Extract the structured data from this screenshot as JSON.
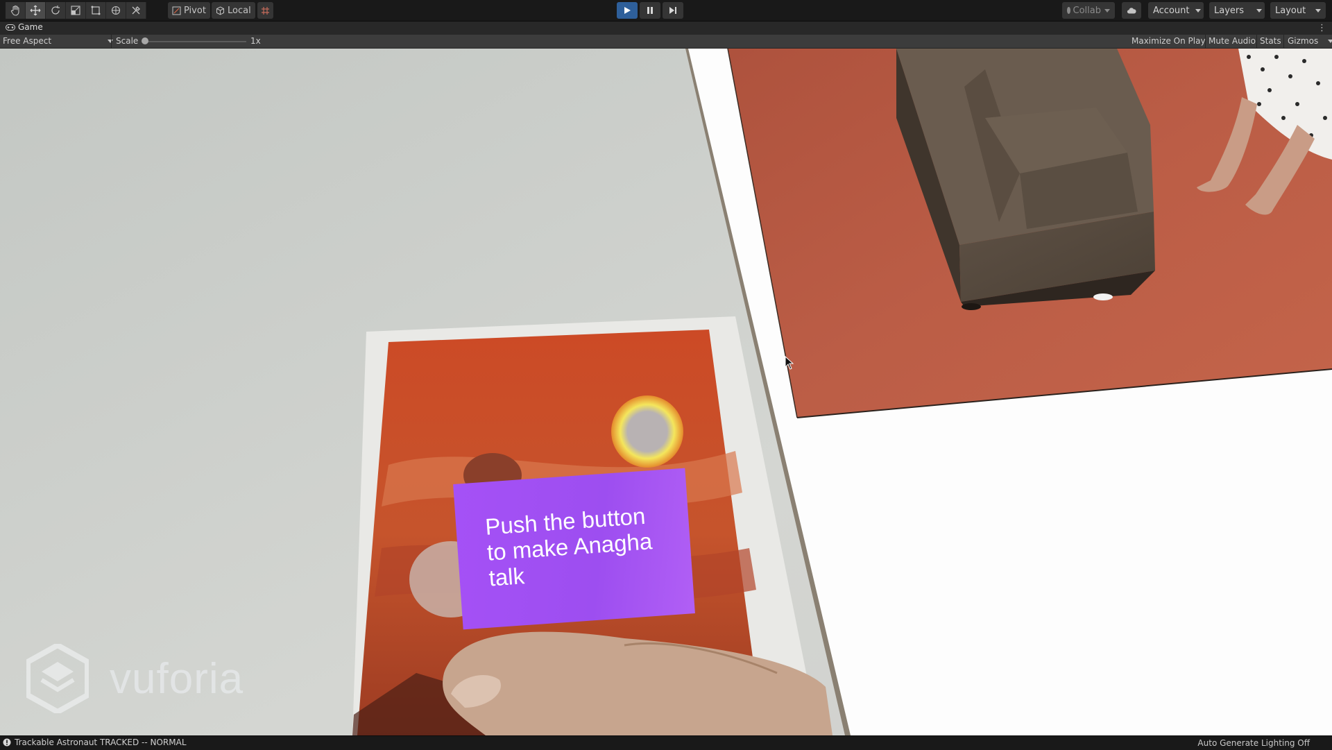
{
  "toolbar": {
    "tools": [
      {
        "name": "hand-tool-icon"
      },
      {
        "name": "move-tool-icon"
      },
      {
        "name": "rotate-tool-icon"
      },
      {
        "name": "scale-tool-icon"
      },
      {
        "name": "rect-tool-icon"
      },
      {
        "name": "transform-tool-icon"
      },
      {
        "name": "custom-tool-icon"
      }
    ],
    "pivot_label": "Pivot",
    "local_label": "Local",
    "collab_label": "Collab",
    "account_label": "Account",
    "layers_label": "Layers",
    "layout_label": "Layout"
  },
  "playmode": {
    "playing": true
  },
  "game_tab": {
    "label": "Game"
  },
  "game_bar": {
    "aspect": "Free Aspect",
    "scale_label": "Scale",
    "scale_value": "1x",
    "maximize_on_play": "Maximize On Play",
    "mute_audio": "Mute Audio",
    "stats": "Stats",
    "gizmos": "Gizmos"
  },
  "viewport": {
    "ar_text": "Push the button to make Anagha talk",
    "watermark": "vuforia"
  },
  "status": {
    "message": "Trackable Astronaut TRACKED -- NORMAL",
    "lighting": "Auto Generate Lighting Off"
  },
  "colors": {
    "accent_play": "#2e5f9a",
    "ar_panel": "#a551f6",
    "floor": "#b85a45"
  }
}
